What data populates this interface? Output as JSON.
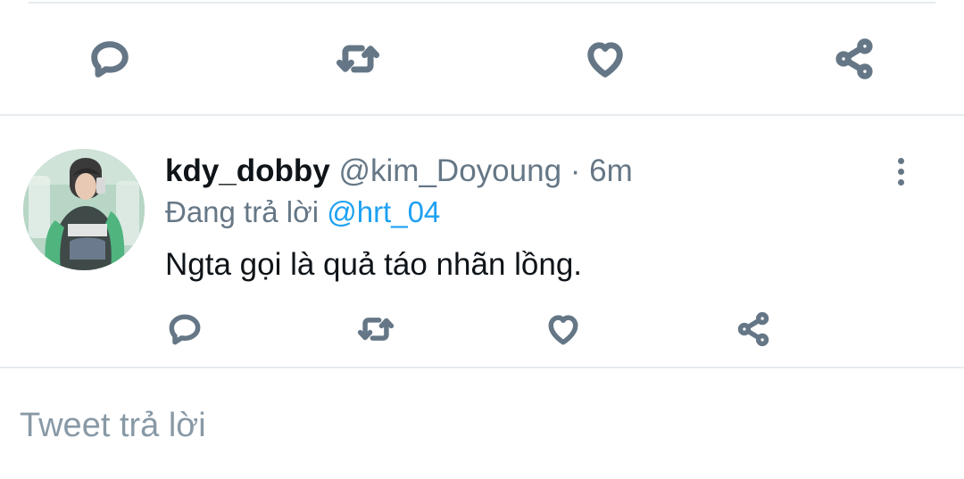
{
  "top_actions": {
    "icons": [
      "reply-icon",
      "retweet-icon",
      "like-icon",
      "share-icon"
    ]
  },
  "tweet": {
    "display_name": "kdy_dobby",
    "handle": "@kim_Doyoung",
    "separator": "·",
    "time": "6m",
    "replying_prefix": "Đang trả lời",
    "replying_to": "@hrt_04",
    "text": "Ngta gọi là quả táo nhãn lồng.",
    "more_icon": "vertical-ellipsis-icon"
  },
  "reply_composer": {
    "placeholder": "Tweet trả lời"
  },
  "colors": {
    "icon_gray": "#657786",
    "mention_blue": "#1da1f2",
    "divider": "#e6ecf0",
    "placeholder": "#8899a6"
  }
}
